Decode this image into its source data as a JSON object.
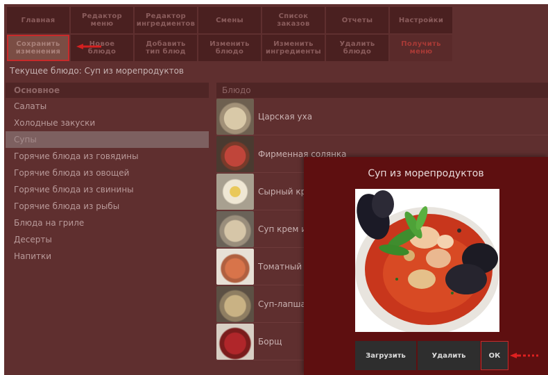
{
  "toolbar": {
    "row1": [
      "Главная",
      "Редактор\nменю",
      "Редактор\nингредиентов",
      "Смены",
      "Список\nзаказов",
      "Отчеты",
      "Настройки"
    ],
    "row2": [
      "Сохранить\nизменения",
      "Новое\nблюдо",
      "Добавить\nтип блюд",
      "Изменить\nблюдо",
      "Изменить\nингредиенты",
      "Удалить\nблюдо",
      "Получить меню"
    ]
  },
  "current_dish": "Текущее блюдо: Суп из морепродуктов",
  "categories": {
    "header": "Основное",
    "items": [
      "Салаты",
      "Холодные закуски",
      "Супы",
      "Горячие блюда из говядины",
      "Горячие блюда из овощей",
      "Горячие блюда из свинины",
      "Горячие блюда из рыбы",
      "Блюда на гриле",
      "Десерты",
      "Напитки"
    ],
    "active": "Супы"
  },
  "dishes": {
    "header": "Блюдо",
    "items": [
      "Царская уха",
      "Фирменная солянка",
      "Сырный кре",
      "Суп крем из",
      "Томатный с",
      "Суп-лапша с",
      "Борщ"
    ]
  },
  "modal": {
    "title": "Суп из морепродуктов",
    "upload_label": "Загрузить",
    "delete_label": "Удалить",
    "ok_label": "ОК"
  },
  "colors": {
    "annotation_red": "#c92a2a",
    "modal_bg": "#5e0f10"
  }
}
